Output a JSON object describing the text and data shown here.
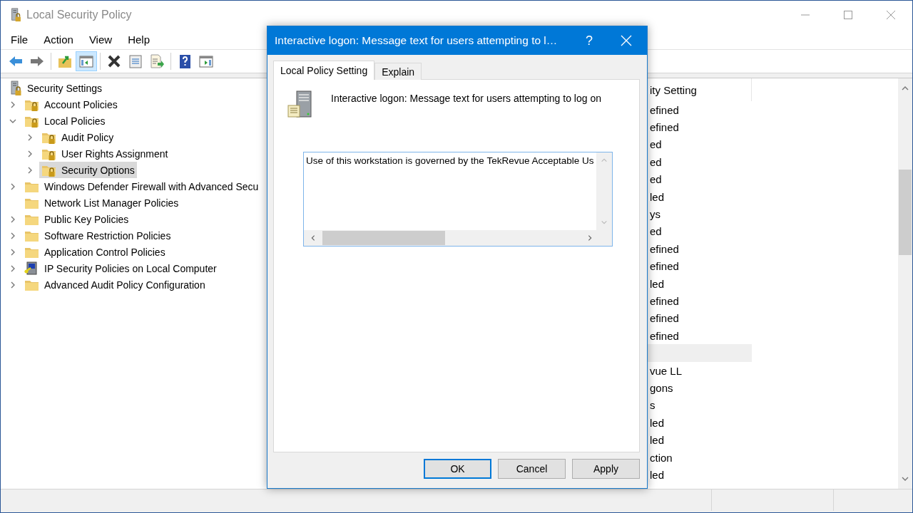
{
  "window": {
    "title": "Local Security Policy"
  },
  "menu": [
    "File",
    "Action",
    "View",
    "Help"
  ],
  "toolbar": [
    {
      "kind": "back",
      "pressed": false
    },
    {
      "kind": "forward",
      "pressed": false
    },
    {
      "kind": "separator"
    },
    {
      "kind": "up",
      "pressed": false
    },
    {
      "kind": "tree-toggle",
      "pressed": true
    },
    {
      "kind": "separator"
    },
    {
      "kind": "delete",
      "pressed": false
    },
    {
      "kind": "properties",
      "pressed": false
    },
    {
      "kind": "export",
      "pressed": false
    },
    {
      "kind": "separator"
    },
    {
      "kind": "help",
      "pressed": false
    },
    {
      "kind": "action-pane",
      "pressed": false
    }
  ],
  "tree": {
    "label": "Security Settings",
    "kind": "root",
    "selected": false,
    "children": [
      {
        "label": "Account Policies",
        "kind": "policy",
        "selected": false,
        "expanded": false,
        "expandable": true
      },
      {
        "label": "Local Policies",
        "kind": "policy",
        "selected": false,
        "expanded": true,
        "expandable": true,
        "children": [
          {
            "label": "Audit Policy",
            "kind": "policy",
            "selected": false,
            "expanded": false,
            "expandable": true
          },
          {
            "label": "User Rights Assignment",
            "kind": "policy",
            "selected": false,
            "expanded": false,
            "expandable": true
          },
          {
            "label": "Security Options",
            "kind": "policy",
            "selected": true,
            "expanded": false,
            "expandable": true
          }
        ]
      },
      {
        "label": "Windows Defender Firewall with Advanced Secu",
        "kind": "folder",
        "selected": false,
        "expanded": false,
        "expandable": true
      },
      {
        "label": "Network List Manager Policies",
        "kind": "folder",
        "selected": false,
        "expandable": false
      },
      {
        "label": "Public Key Policies",
        "kind": "folder",
        "selected": false,
        "expanded": false,
        "expandable": true
      },
      {
        "label": "Software Restriction Policies",
        "kind": "folder",
        "selected": false,
        "expanded": false,
        "expandable": true
      },
      {
        "label": "Application Control Policies",
        "kind": "folder",
        "selected": false,
        "expanded": false,
        "expandable": true
      },
      {
        "label": "IP Security Policies on Local Computer",
        "kind": "computer",
        "selected": false,
        "expanded": false,
        "expandable": true
      },
      {
        "label": "Advanced Audit Policy Configuration",
        "kind": "folder",
        "selected": false,
        "expanded": false,
        "expandable": true
      }
    ]
  },
  "details": {
    "column_2": "ity Setting",
    "rows": [
      {
        "value": "efined",
        "selected": false
      },
      {
        "value": "efined",
        "selected": false
      },
      {
        "value": "ed",
        "selected": false
      },
      {
        "value": "ed",
        "selected": false
      },
      {
        "value": "ed",
        "selected": false
      },
      {
        "value": "led",
        "selected": false
      },
      {
        "value": "ys",
        "selected": false
      },
      {
        "value": "ed",
        "selected": false
      },
      {
        "value": "efined",
        "selected": false
      },
      {
        "value": "efined",
        "selected": false
      },
      {
        "value": "led",
        "selected": false
      },
      {
        "value": "efined",
        "selected": false
      },
      {
        "value": "efined",
        "selected": false
      },
      {
        "value": "efined",
        "selected": false
      },
      {
        "selected": true
      },
      {
        "value": "vue LL",
        "selected": false
      },
      {
        "value": "gons",
        "selected": false
      },
      {
        "value": "s",
        "selected": false
      },
      {
        "value": "led",
        "selected": false
      },
      {
        "value": "led",
        "selected": false
      },
      {
        "value": "ction",
        "selected": false
      },
      {
        "value": "led",
        "selected": false
      }
    ]
  },
  "dialog": {
    "title": "Interactive logon: Message text for users attempting to l…",
    "help": "?",
    "tabs": [
      {
        "label": "Local Policy Setting",
        "selected": true
      },
      {
        "label": "Explain",
        "selected": false
      }
    ],
    "policy_name": "Interactive logon: Message text for users attempting to log on",
    "message_value": "Use of this workstation is governed by the TekRevue Acceptable Us",
    "buttons": [
      {
        "label": "OK",
        "default": true
      },
      {
        "label": "Cancel",
        "default": false
      },
      {
        "label": "Apply",
        "default": false
      }
    ]
  }
}
